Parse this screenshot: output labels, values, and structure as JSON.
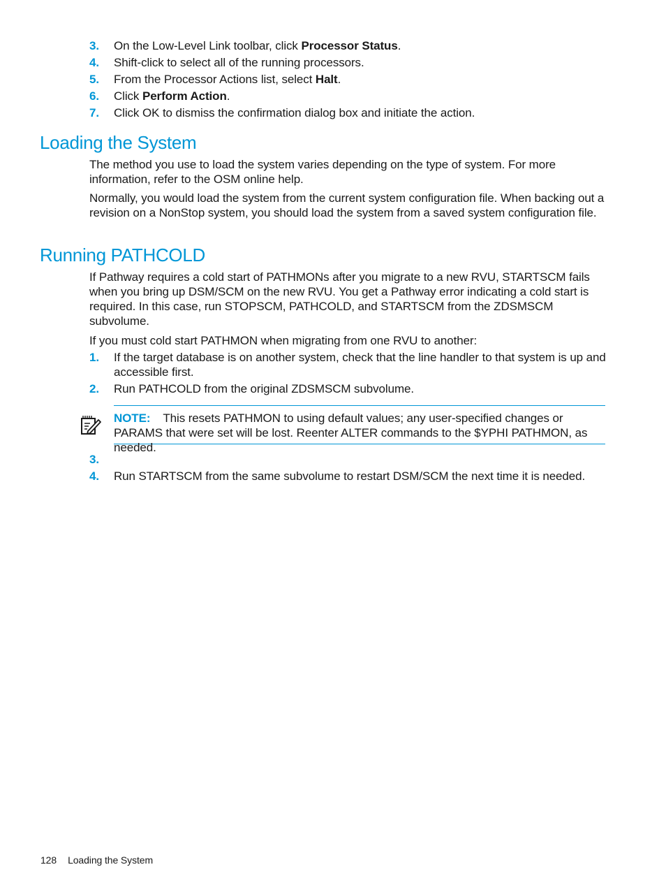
{
  "steps_top": [
    {
      "num": "3.",
      "before": "On the Low-Level Link toolbar, click ",
      "bold": "Processor Status",
      "after": "."
    },
    {
      "num": "4.",
      "before": "Shift-click to select all of the running processors.",
      "bold": "",
      "after": ""
    },
    {
      "num": "5.",
      "before": "From the Processor Actions list, select ",
      "bold": "Halt",
      "after": "."
    },
    {
      "num": "6.",
      "before": "Click ",
      "bold": "Perform Action",
      "after": "."
    },
    {
      "num": "7.",
      "before": "Click OK to dismiss the confirmation dialog box and initiate the action.",
      "bold": "",
      "after": ""
    }
  ],
  "section_loading": {
    "title": "Loading the System",
    "paragraphs": [
      "The method you use to load the system varies depending on the type of system. For more information, refer to the OSM online help.",
      "Normally, you would load the system from the current system configuration file. When backing out a revision on a NonStop system, you should load the system from a saved system configuration file."
    ]
  },
  "section_pathcold": {
    "title": "Running PATHCOLD",
    "paragraphs": [
      "If Pathway requires a cold start of PATHMONs after you migrate to a new RVU, STARTSCM fails when you bring up DSM/SCM on the new RVU. You get a Pathway error indicating a cold start is required. In this case, run STOPSCM, PATHCOLD, and STARTSCM from the ZDSMSCM subvolume.",
      "If you must cold start PATHMON when migrating from one RVU to another:"
    ],
    "steps": [
      {
        "num": "1.",
        "text": "If the target database is on another system, check that the line handler to that system is up and accessible first."
      },
      {
        "num": "2.",
        "text": "Run PATHCOLD from the original ZDSMSCM subvolume."
      }
    ],
    "note": {
      "label": "NOTE:",
      "text": "This resets PATHMON to using default values; any user-specified changes or PARAMS that were set will be lost. Reenter ALTER commands to the $YPHI PATHMON, as needed.",
      "icon": "note-pencil-icon"
    },
    "steps_after": [
      {
        "num": "3.",
        "text": ""
      },
      {
        "num": "4.",
        "text": "Run STARTSCM from the same subvolume to restart DSM/SCM the next time it is needed."
      }
    ]
  },
  "footer": {
    "page_number": "128",
    "section": "Loading the System"
  }
}
